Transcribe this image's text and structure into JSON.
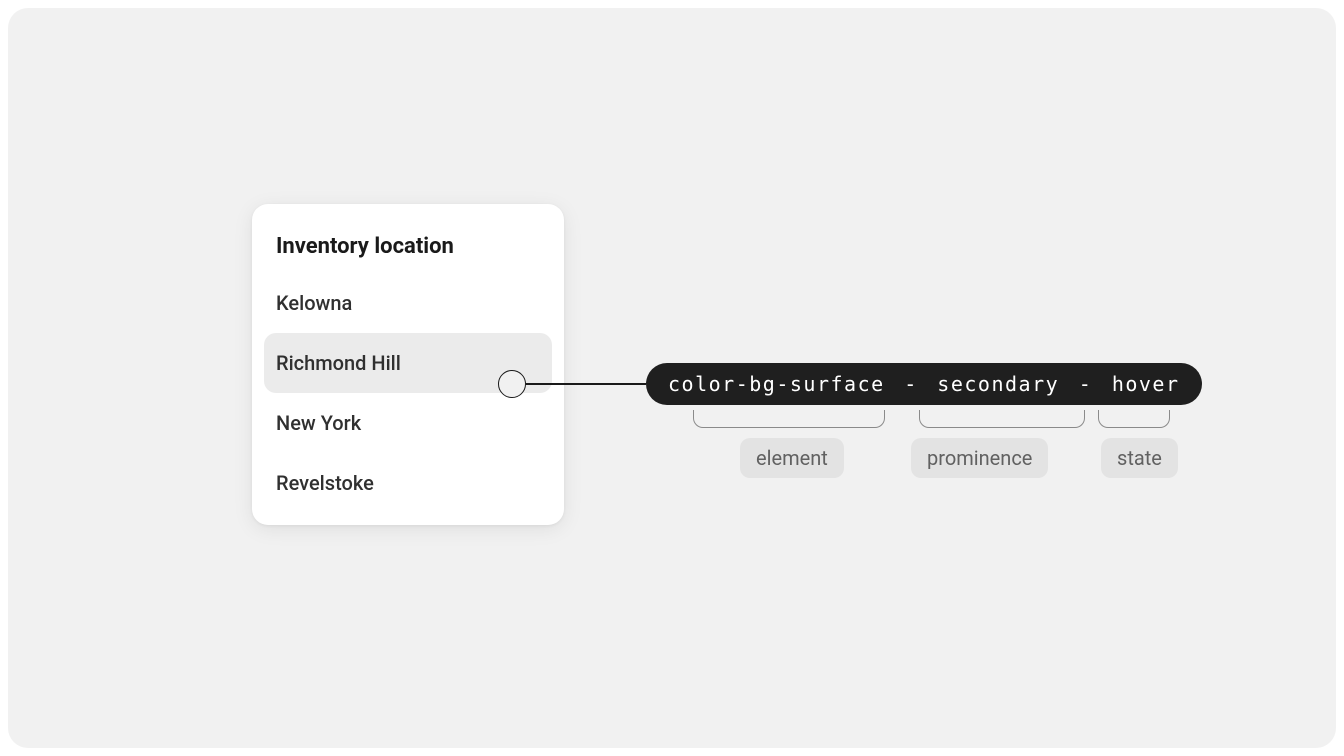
{
  "popover": {
    "title": "Inventory location",
    "items": [
      {
        "label": "Kelowna"
      },
      {
        "label": "Richmond Hill"
      },
      {
        "label": "New York"
      },
      {
        "label": "Revelstoke"
      }
    ],
    "hovered_index": 1
  },
  "token": {
    "part1": "color-bg-surface",
    "sep": "-",
    "part2": "secondary",
    "part3": "hover"
  },
  "legend": {
    "element": "element",
    "prominence": "prominence",
    "state": "state"
  }
}
